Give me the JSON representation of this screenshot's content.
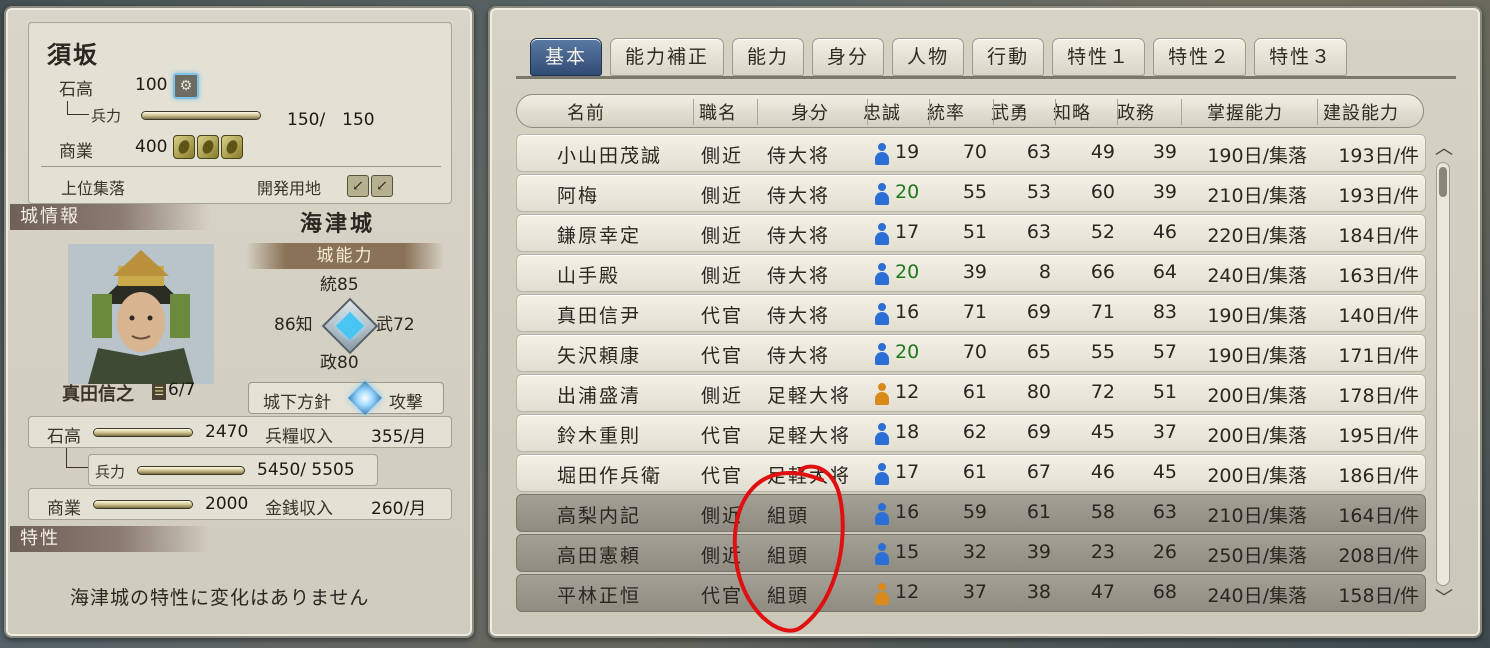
{
  "fief": {
    "name": "須坂",
    "kokudaka_label": "石高",
    "kokudaka_value": "100",
    "troops_label": "兵力",
    "troops_value": "150/　150",
    "troops_ratio": 1.0,
    "commerce_label": "商業",
    "commerce_value": "400",
    "upper_village_label": "上位集落",
    "dev_land_label": "開発用地"
  },
  "castle": {
    "section_label": "城情報",
    "name": "海津城",
    "ability_label": "城能力",
    "stats": {
      "tou_label": "統",
      "tou_value": "85",
      "chi_label": "知",
      "chi_value": "86",
      "bu_label": "武",
      "bu_value": "72",
      "sei_label": "政",
      "sei_value": "80"
    },
    "lord_name": "真田信之",
    "lord_rank": "6/7",
    "policy_label": "城下方針",
    "policy_value": "攻撃",
    "kokudaka_label": "石高",
    "kokudaka_value": "2470",
    "kokudaka_ratio": 1.0,
    "food_income_label": "兵糧収入",
    "food_income_value": "355/月",
    "troops_label": "兵力",
    "troops_value": "5450/ 5505",
    "troops_ratio": 0.99,
    "commerce_label": "商業",
    "commerce_value": "2000",
    "commerce_ratio": 1.0,
    "gold_income_label": "金銭収入",
    "gold_income_value": "260/月"
  },
  "traits": {
    "section_label": "特性",
    "text": "海津城の特性に変化はありません"
  },
  "tabs": [
    "基本",
    "能力補正",
    "能力",
    "身分",
    "人物",
    "行動",
    "特性１",
    "特性２",
    "特性３"
  ],
  "active_tab": "基本",
  "table": {
    "headers": [
      "名前",
      "職名",
      "身分",
      "忠誠",
      "統率",
      "武勇",
      "知略",
      "政務",
      "掌握能力",
      "建設能力"
    ],
    "rows": [
      {
        "name": "小山田茂誠",
        "title": "側近",
        "status": "侍大将",
        "loyalty": "19",
        "loyalty_color": "blue",
        "loyalty_green": false,
        "lead": "70",
        "valor": "63",
        "intel": "49",
        "admin": "39",
        "control": "190日/集落",
        "build": "193日/件",
        "dim": false
      },
      {
        "name": "阿梅",
        "title": "側近",
        "status": "侍大将",
        "loyalty": "20",
        "loyalty_color": "blue",
        "loyalty_green": true,
        "lead": "55",
        "valor": "53",
        "intel": "60",
        "admin": "39",
        "control": "210日/集落",
        "build": "193日/件",
        "dim": false
      },
      {
        "name": "鎌原幸定",
        "title": "側近",
        "status": "侍大将",
        "loyalty": "17",
        "loyalty_color": "blue",
        "loyalty_green": false,
        "lead": "51",
        "valor": "63",
        "intel": "52",
        "admin": "46",
        "control": "220日/集落",
        "build": "184日/件",
        "dim": false
      },
      {
        "name": "山手殿",
        "title": "側近",
        "status": "侍大将",
        "loyalty": "20",
        "loyalty_color": "blue",
        "loyalty_green": true,
        "lead": "39",
        "valor": "8",
        "intel": "66",
        "admin": "64",
        "control": "240日/集落",
        "build": "163日/件",
        "dim": false
      },
      {
        "name": "真田信尹",
        "title": "代官",
        "status": "侍大将",
        "loyalty": "16",
        "loyalty_color": "blue",
        "loyalty_green": false,
        "lead": "71",
        "valor": "69",
        "intel": "71",
        "admin": "83",
        "control": "190日/集落",
        "build": "140日/件",
        "dim": false
      },
      {
        "name": "矢沢頼康",
        "title": "代官",
        "status": "侍大将",
        "loyalty": "20",
        "loyalty_color": "blue",
        "loyalty_green": true,
        "lead": "70",
        "valor": "65",
        "intel": "55",
        "admin": "57",
        "control": "190日/集落",
        "build": "171日/件",
        "dim": false
      },
      {
        "name": "出浦盛清",
        "title": "側近",
        "status": "足軽大将",
        "loyalty": "12",
        "loyalty_color": "orange",
        "loyalty_green": false,
        "lead": "61",
        "valor": "80",
        "intel": "72",
        "admin": "51",
        "control": "200日/集落",
        "build": "178日/件",
        "dim": false
      },
      {
        "name": "鈴木重則",
        "title": "代官",
        "status": "足軽大将",
        "loyalty": "18",
        "loyalty_color": "blue",
        "loyalty_green": false,
        "lead": "62",
        "valor": "69",
        "intel": "45",
        "admin": "37",
        "control": "200日/集落",
        "build": "195日/件",
        "dim": false
      },
      {
        "name": "堀田作兵衛",
        "title": "代官",
        "status": "足軽大将",
        "loyalty": "17",
        "loyalty_color": "blue",
        "loyalty_green": false,
        "lead": "61",
        "valor": "67",
        "intel": "46",
        "admin": "45",
        "control": "200日/集落",
        "build": "186日/件",
        "dim": false
      },
      {
        "name": "高梨内記",
        "title": "側近",
        "status": "組頭",
        "loyalty": "16",
        "loyalty_color": "blue",
        "loyalty_green": false,
        "lead": "59",
        "valor": "61",
        "intel": "58",
        "admin": "63",
        "control": "210日/集落",
        "build": "164日/件",
        "dim": true
      },
      {
        "name": "高田憲頼",
        "title": "側近",
        "status": "組頭",
        "loyalty": "15",
        "loyalty_color": "blue",
        "loyalty_green": false,
        "lead": "32",
        "valor": "39",
        "intel": "23",
        "admin": "26",
        "control": "250日/集落",
        "build": "208日/件",
        "dim": true
      },
      {
        "name": "平林正恒",
        "title": "代官",
        "status": "組頭",
        "loyalty": "12",
        "loyalty_color": "orange",
        "loyalty_green": false,
        "lead": "37",
        "valor": "38",
        "intel": "47",
        "admin": "68",
        "control": "240日/集落",
        "build": "158日/件",
        "dim": true
      }
    ]
  },
  "colors": {
    "loyalty_blue": "#2b6fd6",
    "loyalty_orange": "#d88a1a",
    "loyalty_green_text": "#1f7a1f",
    "active_tab": "#2f4c75",
    "annotation_red": "#e01010"
  },
  "icons": {
    "kokudaka": "family-crest-icon",
    "commerce": "gold-coin-icon",
    "dev_land": "sickle-icon",
    "loyalty": "person-icon",
    "policy": "compass-star-icon",
    "scroll_up": "chevron-up-icon",
    "scroll_down": "chevron-down-icon"
  }
}
